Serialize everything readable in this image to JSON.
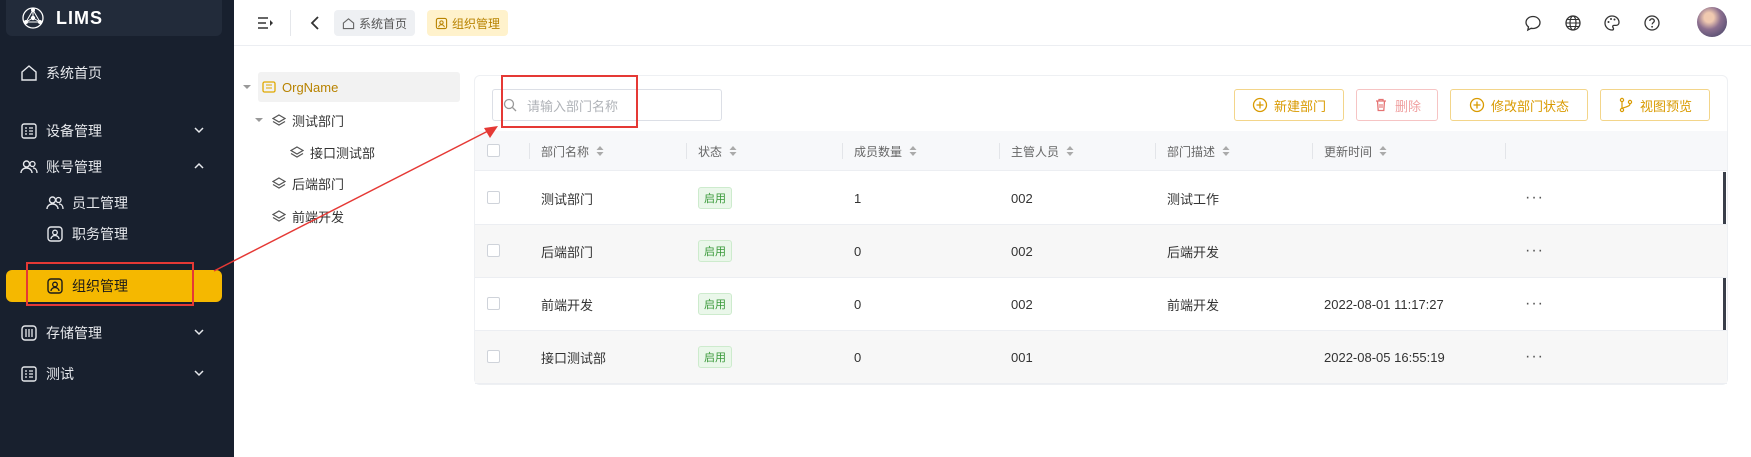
{
  "app": {
    "name": "LIMS"
  },
  "sidebar": {
    "items": [
      {
        "label": "系统首页",
        "icon": "home-icon"
      },
      {
        "label": "设备管理",
        "icon": "list-icon"
      },
      {
        "label": "账号管理",
        "icon": "users-icon"
      },
      {
        "label": "员工管理",
        "icon": "users-icon"
      },
      {
        "label": "职务管理",
        "icon": "badge-icon"
      },
      {
        "label": "组织管理",
        "icon": "badge-icon"
      },
      {
        "label": "存储管理",
        "icon": "storage-icon"
      },
      {
        "label": "测试",
        "icon": "list-icon"
      }
    ]
  },
  "topbar": {
    "breadcrumbs": [
      {
        "label": "系统首页",
        "icon": "home-icon"
      },
      {
        "label": "组织管理",
        "icon": "badge-icon"
      }
    ]
  },
  "tree": {
    "root": "OrgName",
    "nodes": [
      "测试部门",
      "接口测试部",
      "后端部门",
      "前端开发"
    ]
  },
  "toolbar": {
    "search_placeholder": "请输入部门名称",
    "new_label": "新建部门",
    "delete_label": "删除",
    "status_label": "修改部门状态",
    "preview_label": "视图预览"
  },
  "table": {
    "columns": [
      "部门名称",
      "状态",
      "成员数量",
      "主管人员",
      "部门描述",
      "更新时间"
    ],
    "rows": [
      {
        "name": "测试部门",
        "status": "启用",
        "members": "1",
        "manager": "002",
        "desc": "测试工作",
        "updated": ""
      },
      {
        "name": "后端部门",
        "status": "启用",
        "members": "0",
        "manager": "002",
        "desc": "后端开发",
        "updated": ""
      },
      {
        "name": "前端开发",
        "status": "启用",
        "members": "0",
        "manager": "002",
        "desc": "前端开发",
        "updated": "2022-08-01 11:17:27"
      },
      {
        "name": "接口测试部",
        "status": "启用",
        "members": "0",
        "manager": "001",
        "desc": "",
        "updated": "2022-08-05 16:55:19"
      }
    ],
    "more_label": "···"
  },
  "colors": {
    "sidebar_bg": "#18202e",
    "accent": "#f5b800",
    "highlight": "#e53935",
    "status_green": "#3a9a3a"
  }
}
